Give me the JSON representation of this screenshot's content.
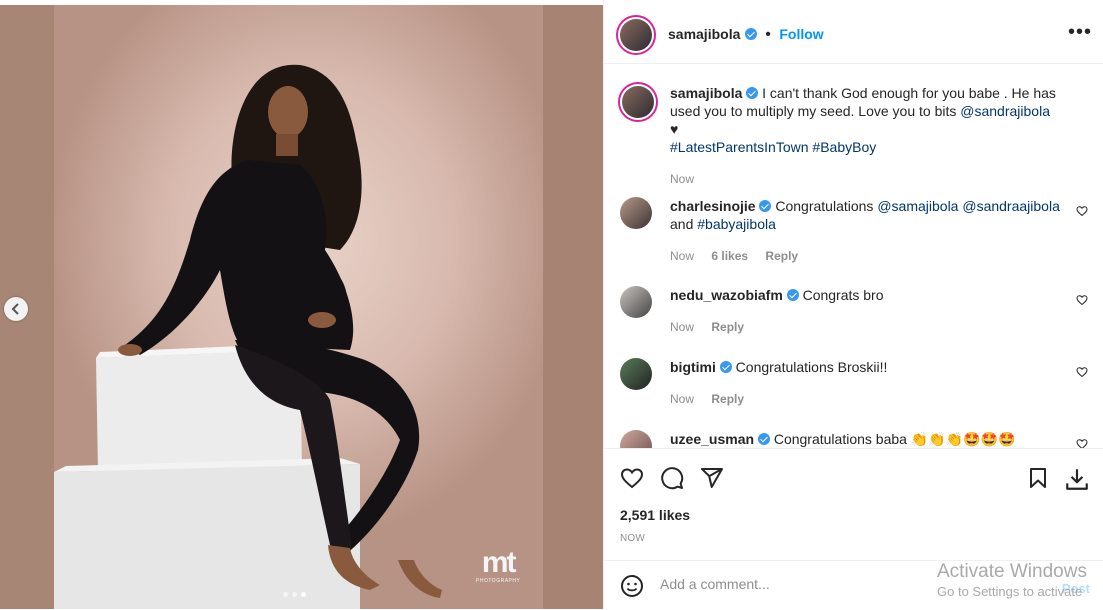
{
  "post": {
    "author": "samajibola",
    "follow_label": "Follow",
    "more_label": "•••",
    "caption_start": "I can't thank God enough for you babe . He has used you to multiply my seed. Love you to bits ",
    "caption_mention": "@sandrajibola",
    "caption_heart": "♥",
    "caption_tags": "#LatestParentsInTown #BabyBoy",
    "caption_time": "Now"
  },
  "comments": [
    {
      "user": "charlesinojie",
      "text_start": "Congratulations ",
      "link1": "@samajibola",
      "link2": "@sandraajibola",
      "and": "and ",
      "link3": "#babyajibola",
      "time": "Now",
      "likes": "6 likes",
      "reply": "Reply"
    },
    {
      "user": "nedu_wazobiafm",
      "text": "Congrats bro",
      "time": "Now",
      "reply": "Reply"
    },
    {
      "user": "bigtimi",
      "text": "Congratulations Broskii!!",
      "time": "Now",
      "reply": "Reply"
    },
    {
      "user": "uzee_usman",
      "text": "Congratulations baba 👏👏👏🤩🤩🤩"
    }
  ],
  "stats": {
    "likes": "2,591 likes",
    "time": "NOW"
  },
  "composer": {
    "placeholder": "Add a comment...",
    "post_label": "Post"
  },
  "watermark": {
    "brand": "mt",
    "sub": "PHOTOGRAPHY"
  },
  "system": {
    "activate_title": "Activate Windows",
    "activate_sub": "Go to Settings to activate"
  },
  "icons": [
    "chevron-left-icon",
    "verified-icon",
    "heart-icon",
    "comment-icon",
    "share-icon",
    "bookmark-icon",
    "download-icon",
    "emoji-icon"
  ],
  "colors": {
    "accent": "#0095f6",
    "verified": "#3897f0",
    "text": "#262626",
    "muted": "#8e8e8e"
  }
}
